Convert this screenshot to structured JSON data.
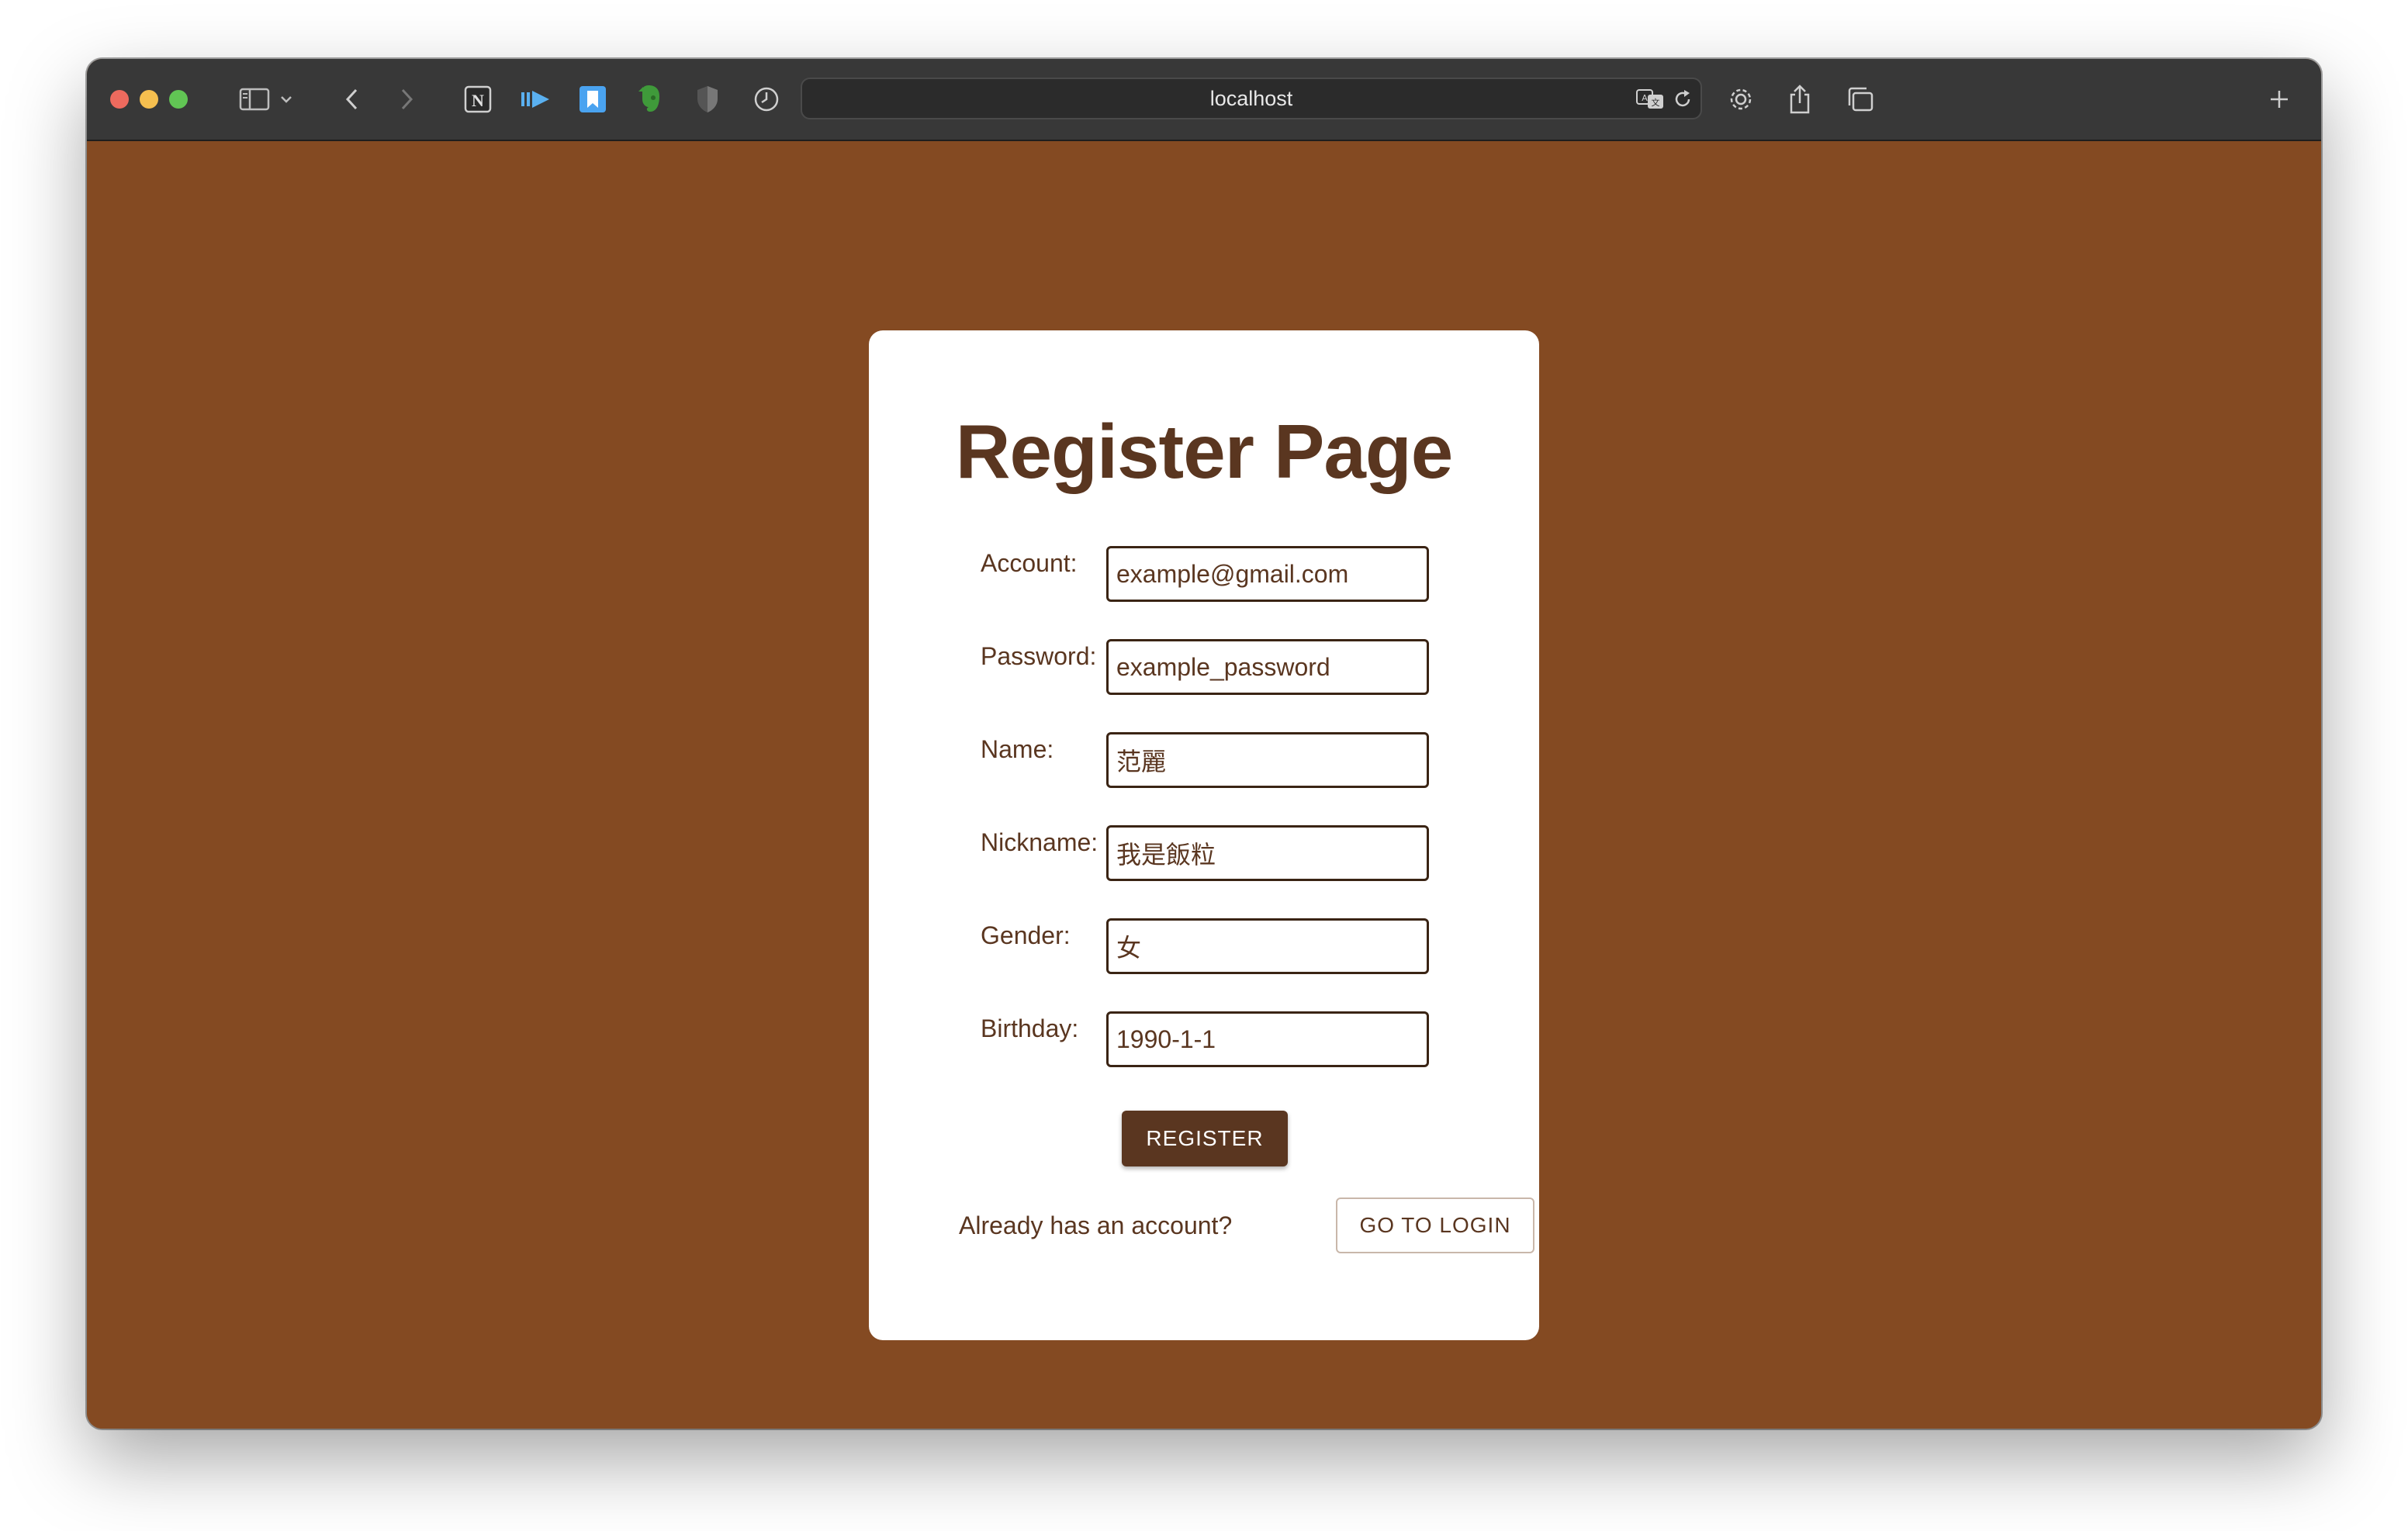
{
  "browser": {
    "url": "localhost",
    "colors": {
      "close": "#ed6a5e",
      "minimize": "#f5bf4f",
      "maximize": "#61c554"
    },
    "toolbar_icons": [
      "sidebar-icon",
      "chevron-down-icon",
      "back-arrow-icon",
      "forward-arrow-icon",
      "notion-extension-icon",
      "media-extension-icon",
      "bookmark-extension-icon",
      "evernote-extension-icon",
      "shield-extension-icon",
      "clock-extension-icon",
      "translate-icon",
      "reload-icon",
      "settings-icon",
      "share-icon",
      "tabs-icon",
      "new-tab-icon"
    ]
  },
  "page": {
    "background": "#844a22",
    "title": "Register Page",
    "fields": [
      {
        "label": "Account:",
        "value": "example@gmail.com"
      },
      {
        "label": "Password:",
        "value": "example_password"
      },
      {
        "label": "Name:",
        "value": "范麗"
      },
      {
        "label": "Nickname:",
        "value": "我是飯粒"
      },
      {
        "label": "Gender:",
        "value": "女"
      },
      {
        "label": "Birthday:",
        "value": "1990-1-1"
      }
    ],
    "register_label": "REGISTER",
    "already_text": "Already has an account?",
    "login_label": "GO TO LOGIN"
  }
}
